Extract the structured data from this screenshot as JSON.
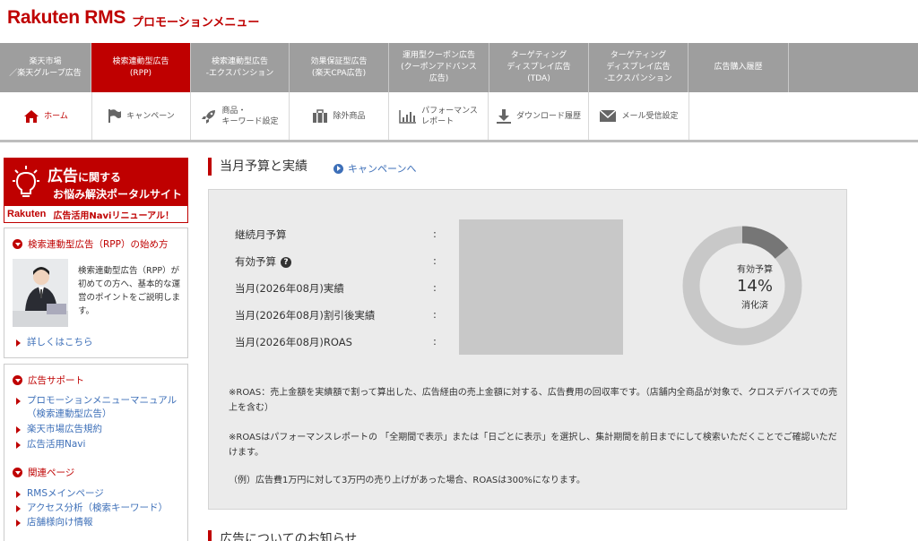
{
  "header": {
    "logo": "Rakuten RMS",
    "subtitle": "プロモーションメニュー"
  },
  "topnav": [
    {
      "label": "楽天市場\n／楽天グループ広告"
    },
    {
      "label": "検索連動型広告\n(RPP)",
      "active": true
    },
    {
      "label": "検索連動型広告\n-エクスパンション"
    },
    {
      "label": "効果保証型広告\n(楽天CPA広告)"
    },
    {
      "label": "運用型クーポン広告\n(クーポンアドバンス\n広告)"
    },
    {
      "label": "ターゲティング\nディスプレイ広告\n(TDA)"
    },
    {
      "label": "ターゲティング\nディスプレイ広告\n-エクスパンション"
    },
    {
      "label": "広告購入履歴"
    }
  ],
  "subnav": [
    {
      "label": "ホーム",
      "icon": "home-icon"
    },
    {
      "label": "キャンペーン",
      "icon": "flag-icon"
    },
    {
      "label": "商品・\nキーワード設定",
      "icon": "rocket-icon"
    },
    {
      "label": "除外商品",
      "icon": "briefcase-icon"
    },
    {
      "label": "パフォーマンス\nレポート",
      "icon": "bar-chart-icon"
    },
    {
      "label": "ダウンロード履歴",
      "icon": "download-icon"
    },
    {
      "label": "メール受信設定",
      "icon": "mail-icon"
    }
  ],
  "sidebar": {
    "banner": {
      "line1_big": "広告",
      "line1_small": "に関する",
      "line2": "お悩み解決ポータルサイト",
      "brand": "Rakuten",
      "renewal": "広告活用Naviリニューアル！"
    },
    "rpp_box": {
      "title": "検索連動型広告（RPP）の始め方",
      "body": "検索連動型広告（RPP）が初めての方へ、基本的な運営のポイントをご説明します。",
      "link": "詳しくはこちら"
    },
    "support_box": {
      "title": "広告サポート",
      "links": [
        "プロモーションメニューマニュアル（検索連動型広告）",
        "楽天市場広告規約",
        "広告活用Navi"
      ]
    },
    "related_box": {
      "title": "関連ページ",
      "links": [
        "RMSメインページ",
        "アクセス分析（検索キーワード）",
        "店舗様向け情報"
      ]
    }
  },
  "main": {
    "title": "当月予算と実績",
    "campaign_link": "キャンペーンへ",
    "rows": [
      {
        "label": "継続月予算",
        "colon": ":"
      },
      {
        "label": "有効予算",
        "colon": ":",
        "help": "?"
      },
      {
        "label": "当月(2026年08月)実績",
        "colon": ":"
      },
      {
        "label": "当月(2026年08月)割引後実績",
        "colon": ":"
      },
      {
        "label": "当月(2026年08月)ROAS",
        "colon": ":"
      }
    ],
    "donut": {
      "title": "有効予算",
      "percent": "14%",
      "percent_value": 0.14,
      "subtitle": "消化済",
      "fill_color": "#767676",
      "track_color": "#c8c8c8"
    },
    "notes": [
      "※ROAS：売上金額を実績額で割って算出した、広告経由の売上金額に対する、広告費用の回収率です。（店舗内全商品が対象で、クロスデバイスでの売上を含む）",
      "※ROASはパフォーマンスレポートの 「全期間で表示」または「日ごとに表示」を選択し、集計期間を前日までにして検索いただくことでご確認いただけます。",
      "（例）広告費1万円に対して3万円の売り上げがあった場合、ROASは300%になります。"
    ],
    "notice_title": "広告についてのお知らせ"
  }
}
